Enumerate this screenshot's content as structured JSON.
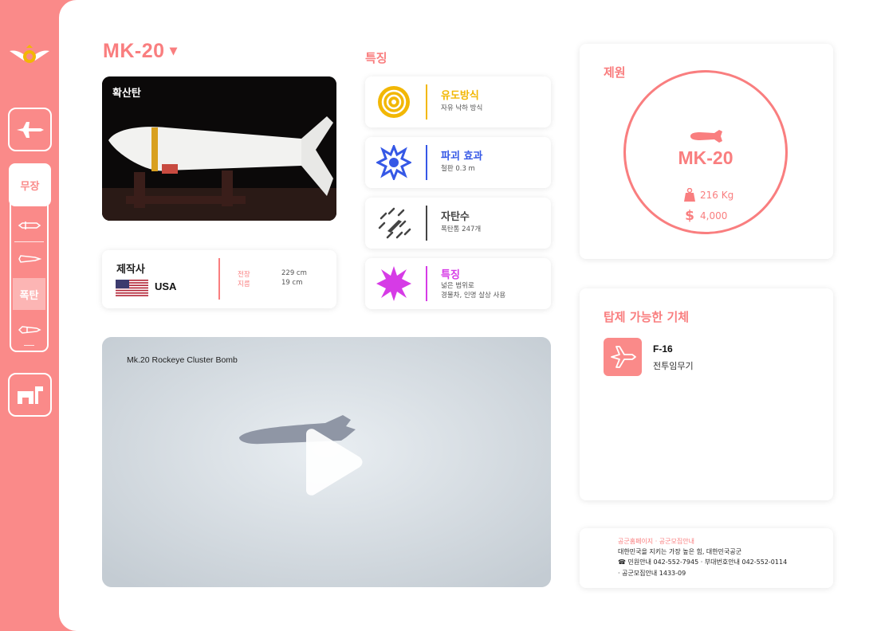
{
  "sidebar": {
    "weapons_label": "무장",
    "bomb_label": "폭탄"
  },
  "weapon": {
    "name": "MK-20",
    "image_label": "확산탄"
  },
  "maker": {
    "label": "제작사",
    "country": "USA",
    "specs": [
      {
        "name": "전장",
        "value": "229 cm"
      },
      {
        "name": "지름",
        "value": "19 cm"
      }
    ]
  },
  "features": {
    "title": "특징",
    "items": [
      {
        "title": "유도방식",
        "desc": [
          "자유 낙하 방식"
        ],
        "color": "#f2b705",
        "icon": "target-icon"
      },
      {
        "title": "파괴 효과",
        "desc": [
          "철판 0.3 m"
        ],
        "color": "#3558e6",
        "icon": "explosion-icon"
      },
      {
        "title": "자탄수",
        "desc": [
          "폭탄통 247개"
        ],
        "color": "#444444",
        "icon": "submunition-icon"
      },
      {
        "title": "특징",
        "desc": [
          "넓은 범위로",
          "경물차, 인명 살상 사용"
        ],
        "color": "#d63be6",
        "icon": "burst-icon"
      }
    ]
  },
  "video": {
    "title": "Mk.20 Rockeye Cluster Bomb"
  },
  "spec": {
    "title": "제원",
    "name": "MK-20",
    "weight": "216 Kg",
    "price": "4,000"
  },
  "platforms": {
    "title": "탑제 가능한 기체",
    "items": [
      {
        "name": "F-16",
        "type": "전투임무기"
      }
    ]
  },
  "footer": {
    "links": "공군홈페이지 · 공군모집안내",
    "slogan": "대한민국을 지키는 가장 높은 힘, 대한민국공군",
    "contact": "☎ 민원안내  042-552-7945  · 부대번호안내  042-552-0114",
    "recruit": "· 공군모집안내  1433-09"
  },
  "colors": {
    "accent": "#fa8a89",
    "accent_text": "#f97e7f"
  }
}
